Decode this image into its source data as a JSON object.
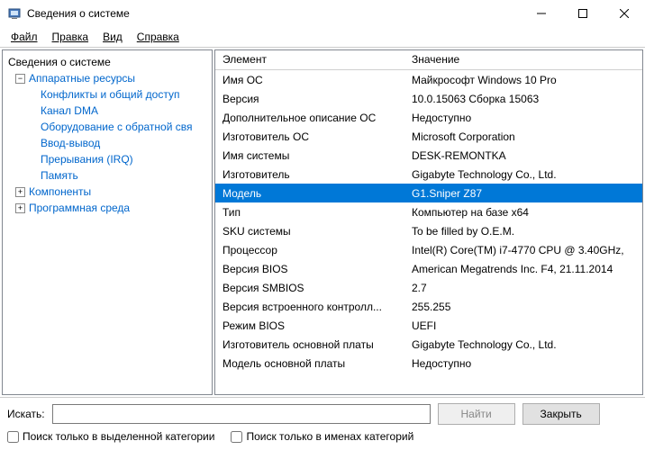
{
  "window": {
    "title": "Сведения о системе"
  },
  "menu": {
    "file": "Файл",
    "edit": "Правка",
    "view": "Вид",
    "help": "Справка"
  },
  "tree": {
    "root": "Сведения о системе",
    "hw": "Аппаратные ресурсы",
    "hw_items": [
      "Конфликты и общий доступ",
      "Канал DMA",
      "Оборудование с обратной свя",
      "Ввод-вывод",
      "Прерывания (IRQ)",
      "Память"
    ],
    "components": "Компоненты",
    "softenv": "Программная среда"
  },
  "table": {
    "header_element": "Элемент",
    "header_value": "Значение",
    "rows": [
      {
        "k": "Имя ОС",
        "v": "Майкрософт Windows 10 Pro"
      },
      {
        "k": "Версия",
        "v": "10.0.15063 Сборка 15063"
      },
      {
        "k": "Дополнительное описание ОС",
        "v": "Недоступно"
      },
      {
        "k": "Изготовитель ОС",
        "v": "Microsoft Corporation"
      },
      {
        "k": "Имя системы",
        "v": "DESK-REMONTKA"
      },
      {
        "k": "Изготовитель",
        "v": "Gigabyte Technology Co., Ltd."
      },
      {
        "k": "Модель",
        "v": "G1.Sniper Z87",
        "selected": true
      },
      {
        "k": "Тип",
        "v": "Компьютер на базе x64"
      },
      {
        "k": "SKU системы",
        "v": "To be filled by O.E.M."
      },
      {
        "k": "Процессор",
        "v": "Intel(R) Core(TM) i7-4770 CPU @ 3.40GHz,"
      },
      {
        "k": "Версия BIOS",
        "v": "American Megatrends Inc. F4, 21.11.2014"
      },
      {
        "k": "Версия SMBIOS",
        "v": "2.7"
      },
      {
        "k": "Версия встроенного контролл...",
        "v": "255.255"
      },
      {
        "k": "Режим BIOS",
        "v": "UEFI"
      },
      {
        "k": "Изготовитель основной платы",
        "v": "Gigabyte Technology Co., Ltd."
      },
      {
        "k": "Модель основной платы",
        "v": "Недоступно"
      }
    ]
  },
  "search": {
    "label": "Искать:",
    "placeholder": "",
    "find_btn": "Найти",
    "close_btn": "Закрыть",
    "cb1": "Поиск только в выделенной категории",
    "cb2": "Поиск только в именах категорий"
  }
}
